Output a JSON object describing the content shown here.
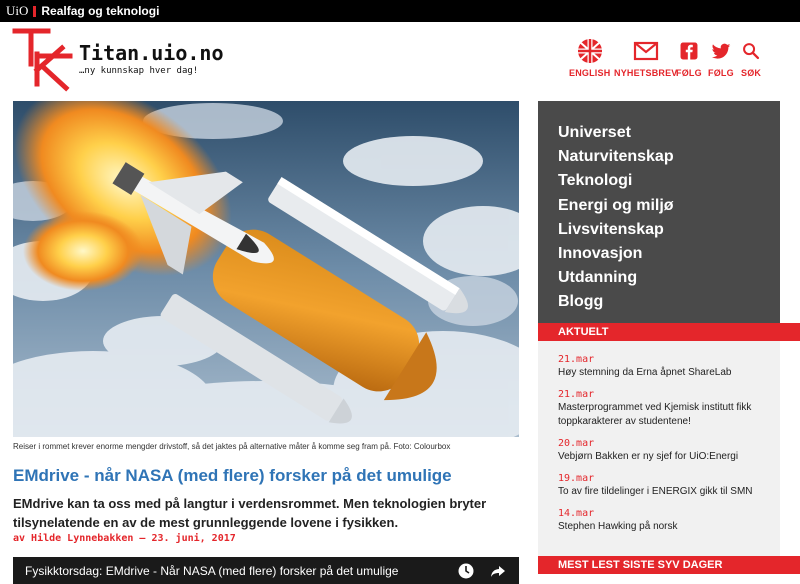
{
  "topbar": {
    "uio": "UiO",
    "org": "Realfag og teknologi"
  },
  "header": {
    "title": "Titan.uio.no",
    "tagline": "…ny kunnskap hver dag!",
    "icons": [
      {
        "name": "uk-flag-icon",
        "label": "ENGLISH"
      },
      {
        "name": "envelope-icon",
        "label": "NYHETSBREV"
      },
      {
        "name": "facebook-icon",
        "label": "FØLG"
      },
      {
        "name": "twitter-icon",
        "label": "FØLG"
      },
      {
        "name": "search-icon",
        "label": "SØK"
      }
    ]
  },
  "article": {
    "caption": "Reiser i rommet krever enorme mengder drivstoff, så det jaktes på alternative måter å komme seg fram på. Foto: Colourbox",
    "headline": "EMdrive - når NASA (med flere) forsker på det umulige",
    "lead": "EMdrive kan ta oss med på langtur i verdensrommet. Men teknologien bryter tilsynelatende en av de mest grunnleggende lovene i fysikken.",
    "byline": "av Hilde Lynnebakken – 23. juni, 2017",
    "video_title": "Fysikktorsdag: EMdrive - Når NASA (med flere) forsker på det umulige"
  },
  "categories": [
    "Universet",
    "Naturvitenskap",
    "Teknologi",
    "Energi og miljø",
    "Livsvitenskap",
    "Innovasjon",
    "Utdanning",
    "Blogg"
  ],
  "aktuelt": {
    "heading": "AKTUELT",
    "items": [
      {
        "date": "21.mar",
        "text": "Høy stemning da Erna åpnet ShareLab"
      },
      {
        "date": "21.mar",
        "text": "Masterprogrammet ved Kjemisk institutt fikk toppkarakterer av studentene!"
      },
      {
        "date": "20.mar",
        "text": "Vebjørn Bakken er ny sjef for UiO:Energi"
      },
      {
        "date": "19.mar",
        "text": "To av fire tildelinger i ENERGIX gikk til SMN"
      },
      {
        "date": "14.mar",
        "text": "Stephen Hawking på norsk"
      }
    ]
  },
  "mest_lest": {
    "heading": "MEST LEST SISTE SYV DAGER"
  },
  "colors": {
    "accent": "#e4262b",
    "link": "#2f74b6",
    "dark": "#4a4a4a"
  }
}
